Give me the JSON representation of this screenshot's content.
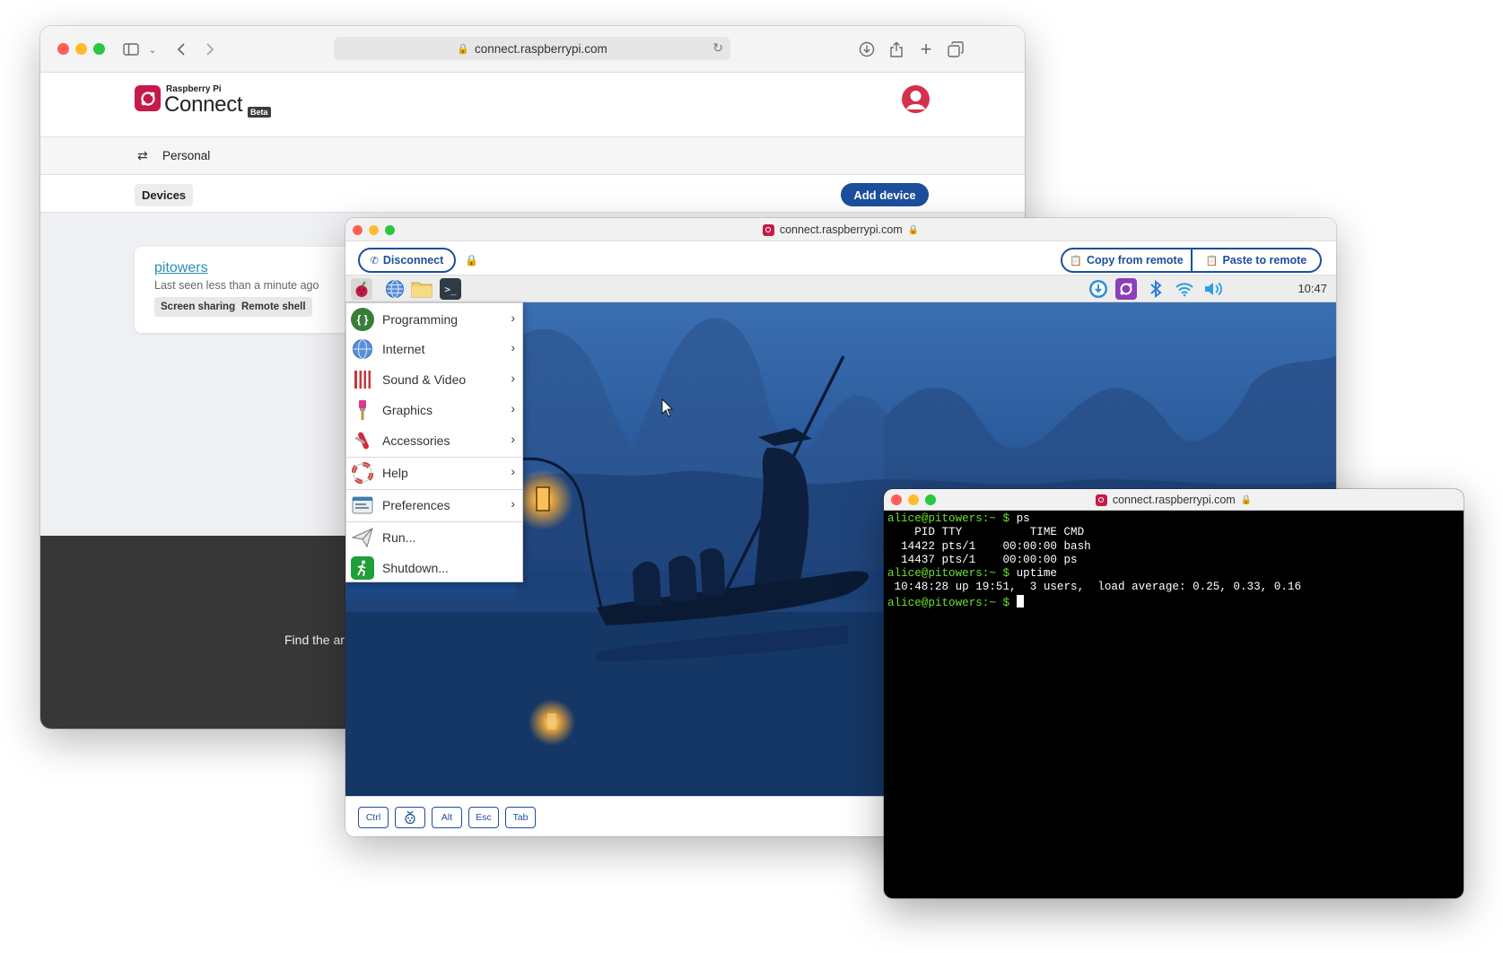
{
  "browser": {
    "url": "connect.raspberrypi.com",
    "icons": [
      "sidebar-icon",
      "chevron-down-icon",
      "back-icon",
      "forward-icon",
      "download-icon",
      "share-icon",
      "new-tab-icon",
      "tabs-icon",
      "reload-icon",
      "lock-icon"
    ]
  },
  "site": {
    "brand_small": "Raspberry Pi",
    "brand_big": "Connect",
    "beta": "Beta",
    "workspace": "Personal",
    "tab": "Devices",
    "add_button": "Add device",
    "device": {
      "name": "pitowers",
      "last_seen": "Last seen less than a minute ago",
      "actions": [
        "Screen sharing",
        "Remote shell"
      ]
    },
    "footer_text": "Find the ar"
  },
  "share_window": {
    "title": "connect.raspberrypi.com",
    "disconnect": "Disconnect",
    "copy_from_remote": "Copy from remote",
    "paste_to_remote": "Paste to remote",
    "clock": "10:47",
    "menu": [
      {
        "label": "Programming",
        "icon": "programming-icon"
      },
      {
        "label": "Internet",
        "icon": "internet-icon"
      },
      {
        "label": "Sound & Video",
        "icon": "sound-video-icon"
      },
      {
        "label": "Graphics",
        "icon": "graphics-icon"
      },
      {
        "label": "Accessories",
        "icon": "accessories-icon"
      },
      {
        "label": "Help",
        "icon": "help-icon"
      },
      {
        "label": "Preferences",
        "icon": "preferences-icon"
      },
      {
        "label": "Run...",
        "icon": "run-icon"
      },
      {
        "label": "Shutdown...",
        "icon": "shutdown-icon"
      }
    ],
    "keys": [
      "Ctrl",
      "Alt",
      "Esc",
      "Tab"
    ]
  },
  "terminal": {
    "title": "connect.raspberrypi.com",
    "prompt": "alice@pitowers:~ $",
    "lines": [
      {
        "type": "cmd",
        "text": " ps"
      },
      {
        "type": "out",
        "text": "    PID TTY          TIME CMD"
      },
      {
        "type": "out",
        "text": "  14422 pts/1    00:00:00 bash"
      },
      {
        "type": "out",
        "text": "  14437 pts/1    00:00:00 ps"
      },
      {
        "type": "cmd",
        "text": " uptime"
      },
      {
        "type": "out",
        "text": " 10:48:28 up 19:51,  3 users,  load average: 0.25, 0.33, 0.16"
      },
      {
        "type": "cursor",
        "text": " "
      }
    ]
  },
  "colors": {
    "accent": "#1b4f9c",
    "brand": "#c51a4a",
    "prompt": "#6ee12c",
    "desktop_sky": "#1e4c8c"
  }
}
